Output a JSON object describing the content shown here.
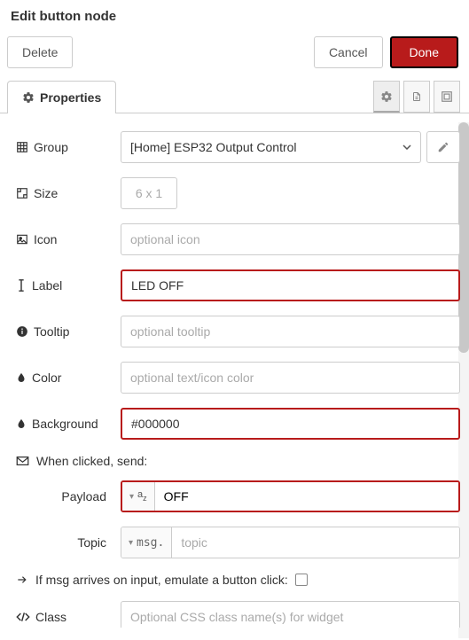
{
  "title": "Edit button node",
  "buttons": {
    "delete": "Delete",
    "cancel": "Cancel",
    "done": "Done"
  },
  "tabs": {
    "properties": "Properties"
  },
  "form": {
    "group": {
      "label": "Group",
      "value": "[Home] ESP32 Output Control"
    },
    "size": {
      "label": "Size",
      "value": "6 x 1"
    },
    "icon": {
      "label": "Icon",
      "value": "",
      "placeholder": "optional icon"
    },
    "label": {
      "label": "Label",
      "value": "LED OFF"
    },
    "tooltip": {
      "label": "Tooltip",
      "value": "",
      "placeholder": "optional tooltip"
    },
    "color": {
      "label": "Color",
      "value": "",
      "placeholder": "optional text/icon color"
    },
    "background": {
      "label": "Background",
      "value": "#000000"
    },
    "when_clicked": "When clicked, send:",
    "payload": {
      "label": "Payload",
      "value": "OFF"
    },
    "topic": {
      "label": "Topic",
      "prefix": "msg.",
      "value": "",
      "placeholder": "topic"
    },
    "emulate": {
      "label": "If msg arrives on input, emulate a button click:",
      "checked": false
    },
    "class": {
      "label": "Class",
      "value": "",
      "placeholder": "Optional CSS class name(s) for widget"
    }
  }
}
